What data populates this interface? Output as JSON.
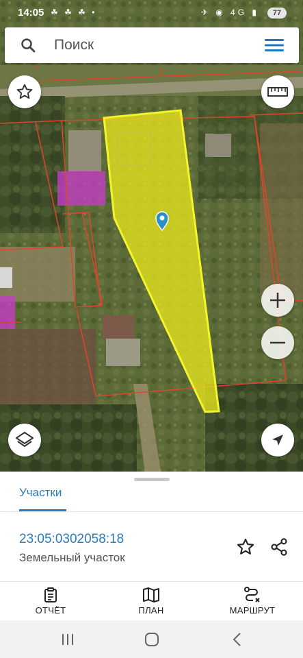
{
  "status_bar": {
    "time": "14:05",
    "left_icons": "☘ ☘ ☘ •",
    "right_icons": "✈ ◉ 4G ▮",
    "battery": "77"
  },
  "search": {
    "placeholder": "Поиск",
    "icon": "search-icon",
    "menu_icon": "hamburger-menu-icon"
  },
  "map": {
    "buttons": {
      "favorite": "star-icon",
      "ruler": "ruler-icon",
      "zoom_in": "plus-icon",
      "zoom_out": "minus-icon",
      "layers": "layers-icon",
      "location": "navigation-arrow-icon"
    },
    "colors": {
      "parcel_fill": "#e5e51e",
      "parcel_border": "#f4f42a",
      "boundary": "#e0452c",
      "building": "#c33dc3",
      "pin": "#2a8fc4"
    }
  },
  "sheet": {
    "tab_label": "Участки",
    "cadastral_number": "23:05:0302058:18",
    "object_type": "Земельный участок",
    "accent_color": "#2a7dbc"
  },
  "toolbar": {
    "report_label": "ОТЧЁТ",
    "plan_label": "ПЛАН",
    "route_label": "МАРШРУТ"
  },
  "navigation": {
    "recents": "recents-icon",
    "home": "home-icon",
    "back": "back-icon"
  }
}
